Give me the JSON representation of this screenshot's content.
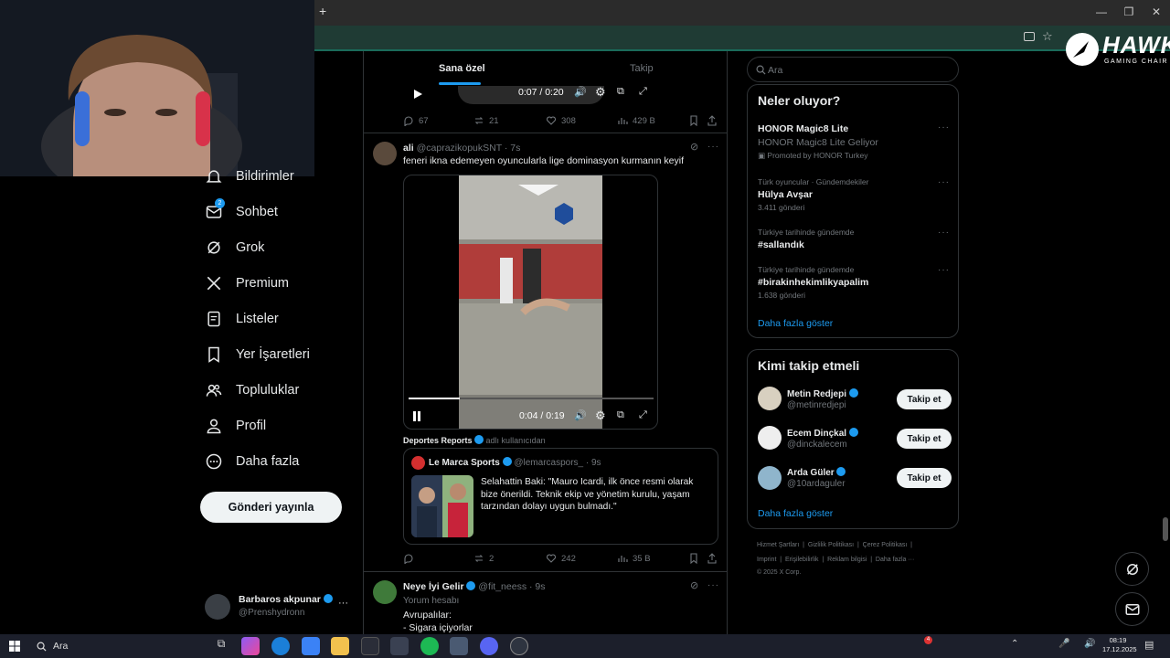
{
  "browser": {
    "new_tab": "+",
    "win_min": "—",
    "win_max": "❐",
    "win_close": "✕"
  },
  "brand": {
    "logo_text": "HAWK",
    "logo_sub": "GAMING CHAIR"
  },
  "sidebar": {
    "items": [
      {
        "label": "Bildirimler",
        "icon": "bell-icon"
      },
      {
        "label": "Sohbet",
        "icon": "mail-icon",
        "badge": "2"
      },
      {
        "label": "Grok",
        "icon": "grok-icon"
      },
      {
        "label": "Premium",
        "icon": "x-logo-icon"
      },
      {
        "label": "Listeler",
        "icon": "list-icon"
      },
      {
        "label": "Yer İşaretleri",
        "icon": "bookmark-icon"
      },
      {
        "label": "Topluluklar",
        "icon": "people-icon"
      },
      {
        "label": "Profil",
        "icon": "person-icon"
      },
      {
        "label": "Daha fazla",
        "icon": "more-circle-icon"
      }
    ],
    "post_button": "Gönderi yayınla",
    "account": {
      "name": "Barbaros akpunar",
      "handle": "@Prenshydronn",
      "more": "···"
    }
  },
  "timeline": {
    "tabs": [
      "Sana özel",
      "Takip"
    ],
    "first_post": {
      "video_time": "0:07 / 0:20",
      "replies": "67",
      "reposts": "21",
      "likes": "308",
      "views": "429 B"
    },
    "post": {
      "author": "ali",
      "handle": "@caprazikopukSNT",
      "time": "· 7s",
      "text": "feneri ikna edemeyen oyuncularla lige dominasyon kurmanın keyif",
      "video_time": "0:04 / 0:19",
      "video_progress": 0.21,
      "source_name": "Deportes Reports",
      "source_suffix": "adlı kullanıcıdan",
      "quote": {
        "author": "Le Marca Sports",
        "handle": "@lemarcaspors_",
        "time": "· 9s",
        "text": "Selahattin Baki: \"Mauro Icardi, ilk önce resmi olarak bize önerildi. Teknik ekip ve yönetim kurulu, yaşam tarzından dolayı uygun bulmadı.\""
      },
      "replies": "",
      "reposts": "2",
      "likes": "242",
      "views": "35 B"
    },
    "next_post": {
      "author": "Neye İyi Gelir",
      "handle": "@fit_neess",
      "time": "· 9s",
      "label": "Yorum hesabı",
      "line1": "Avrupalılar:",
      "line2": "- Sigara içiyorlar"
    }
  },
  "right": {
    "search_placeholder": "Ara",
    "trends_title": "Neler oluyor?",
    "trends": [
      {
        "meta": "",
        "title": "HONOR Magic8 Lite",
        "sub": "HONOR Magic8 Lite Geliyor",
        "promo": "Promoted by HONOR Turkey"
      },
      {
        "meta": "Türk oyuncular · Gündemdekiler",
        "title": "Hülya Avşar",
        "sub": "3.411 gönderi"
      },
      {
        "meta": "Türkiye tarihinde gündemde",
        "title": "#sallandık",
        "sub": ""
      },
      {
        "meta": "Türkiye tarihinde gündemde",
        "title": "#birakinhekimlikyapalim",
        "sub": "1.638 gönderi"
      }
    ],
    "trends_more": "Daha fazla göster",
    "follow_title": "Kimi takip etmeli",
    "follow": [
      {
        "name": "Metin Redjepi",
        "handle": "@metinredjepi",
        "button": "Takip et"
      },
      {
        "name": "Ecem Dinçkal",
        "handle": "@dinckalecem",
        "button": "Takip et"
      },
      {
        "name": "Arda Güler",
        "handle": "@10ardaguler",
        "button": "Takip et"
      }
    ],
    "follow_more": "Daha fazla göster",
    "footer_line1": "Hizmet Şartları  |  Gizlilik Politikası  |  Çerez Politikası  |",
    "footer_line2": "Imprint  |  Erişilebilirlik  |  Reklam bilgisi  |  Daha fazla ···",
    "footer_line3": "© 2025 X Corp."
  },
  "taskbar": {
    "search": "Ara",
    "time": "08:19",
    "date": "17.12.2025",
    "badge": "4"
  },
  "colors": {
    "accent": "#1d9bf0",
    "bg": "#000000",
    "border": "#2f3336",
    "muted": "#71767b"
  }
}
